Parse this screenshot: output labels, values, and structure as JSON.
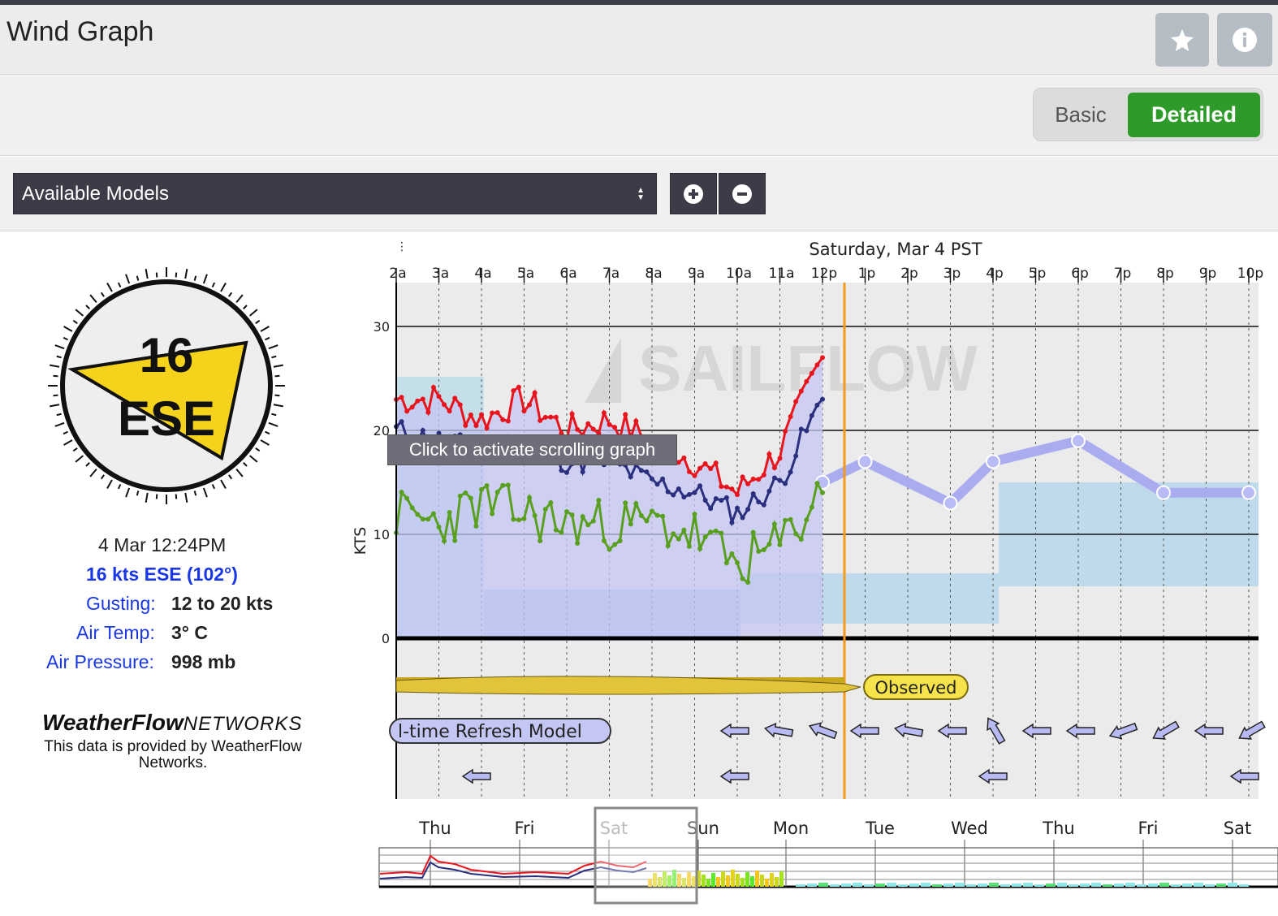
{
  "header": {
    "title": "Wind Graph",
    "favorite_icon": "star-icon",
    "info_icon": "info-icon"
  },
  "view_toggle": {
    "basic_label": "Basic",
    "detailed_label": "Detailed",
    "selected": "Detailed"
  },
  "models": {
    "select_value": "Available Models",
    "zoom_in_icon": "plus-circle-icon",
    "zoom_out_icon": "minus-circle-icon"
  },
  "compass": {
    "speed": "16",
    "direction": "ESE",
    "heading_deg": 102
  },
  "readings": {
    "timestamp": "4 Mar 12:24PM",
    "wind": "16 kts ESE (102°)",
    "gusting_label": "Gusting",
    "gusting_value": "12 to 20 kts",
    "air_temp_label": "Air Temp",
    "air_temp_value": "3° C",
    "air_pressure_label": "Air Pressure",
    "air_pressure_value": "998 mb"
  },
  "provider": {
    "logo_main": "WeatherFlow",
    "logo_suffix": "NETWORKS",
    "description": "This data is provided by WeatherFlow Networks."
  },
  "graph": {
    "date_title": "Saturday, Mar 4 PST",
    "tooltip": "Click to activate scrolling graph",
    "watermark": "SAILFLOW",
    "ylabel": "KTS",
    "observed_label": "Observed",
    "model_label": "l-time Refresh Model",
    "hour_ticks": [
      "2a",
      "3a",
      "4a",
      "5a",
      "6a",
      "7a",
      "8a",
      "9a",
      "10a",
      "11a",
      "12p",
      "1p",
      "2p",
      "3p",
      "4p",
      "5p",
      "6p",
      "7p",
      "8p",
      "9p",
      "10p"
    ],
    "y_ticks": [
      "30",
      "20",
      "10",
      "0"
    ],
    "overview_days": [
      "Thu",
      "Fri",
      "Sat",
      "Sun",
      "Mon",
      "Tue",
      "Wed",
      "Thu",
      "Fri",
      "Sat"
    ]
  },
  "chart_data": {
    "type": "line",
    "ylim": [
      0,
      30
    ],
    "x": [
      "2a",
      "3a",
      "4a",
      "5a",
      "6a",
      "7a",
      "8a",
      "9a",
      "10a",
      "11a",
      "12p"
    ],
    "series": [
      {
        "values": [
          23,
          23,
          21,
          23,
          20,
          21,
          19,
          17,
          14,
          18,
          27
        ]
      },
      {
        "values": [
          20,
          19,
          18,
          19,
          17,
          17,
          15,
          14,
          12,
          15,
          23
        ]
      },
      {
        "values": [
          12,
          11,
          13,
          12,
          11,
          11,
          11,
          10,
          7,
          9,
          14
        ]
      }
    ],
    "forecast_values": [
      15,
      17,
      13,
      17,
      19,
      14,
      14
    ],
    "forecast_x": [
      "12p",
      "1p",
      "3p",
      "4p",
      "6p",
      "8p",
      "10p"
    ],
    "colors": {
      "gust": "#e8141e",
      "avg": "#2a2f7e",
      "lull": "#5aa020",
      "forecast": "#a9adf0",
      "now": "#f39a1e"
    }
  }
}
